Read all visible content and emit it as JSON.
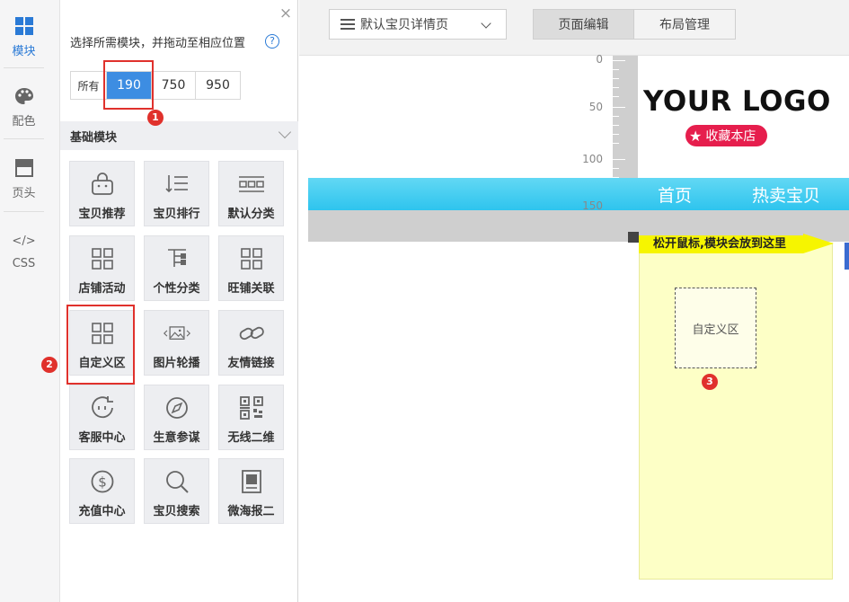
{
  "rail": {
    "items": [
      {
        "label": "模块",
        "icon": "grid-icon",
        "active": true
      },
      {
        "label": "配色",
        "icon": "palette-icon",
        "active": false
      },
      {
        "label": "页头",
        "icon": "header-icon",
        "active": false
      },
      {
        "label": "CSS",
        "icon": "code-icon",
        "active": false
      }
    ],
    "css_glyph": "</>"
  },
  "panel": {
    "close_glyph": "×",
    "hint": "选择所需模块，并拖动至相应位置",
    "help_glyph": "?",
    "width_options": [
      "所有",
      "190",
      "750",
      "950"
    ],
    "selected_width": "190",
    "section_title": "基础模块",
    "modules": [
      {
        "label": "宝贝推荐",
        "icon": "bag-icon"
      },
      {
        "label": "宝贝排行",
        "icon": "sort-list-icon"
      },
      {
        "label": "默认分类",
        "icon": "category-bars-icon"
      },
      {
        "label": "店铺活动",
        "icon": "grid-four-icon"
      },
      {
        "label": "个性分类",
        "icon": "tree-icon"
      },
      {
        "label": "旺铺关联",
        "icon": "grid-four-icon"
      },
      {
        "label": "自定义区",
        "icon": "grid-four-icon"
      },
      {
        "label": "图片轮播",
        "icon": "image-carousel-icon"
      },
      {
        "label": "友情链接",
        "icon": "link-icon"
      },
      {
        "label": "客服中心",
        "icon": "service-face-icon"
      },
      {
        "label": "生意参谋",
        "icon": "compass-icon"
      },
      {
        "label": "无线二维",
        "icon": "qrcode-icon"
      },
      {
        "label": "充值中心",
        "icon": "dollar-icon"
      },
      {
        "label": "宝贝搜索",
        "icon": "search-icon"
      },
      {
        "label": "微海报二",
        "icon": "poster-icon"
      }
    ]
  },
  "annotations": [
    "1",
    "2",
    "3"
  ],
  "toolbar": {
    "page_select": "默认宝贝详情页",
    "tabs": [
      "页面编辑",
      "布局管理"
    ],
    "active_tab": "页面编辑"
  },
  "ruler": {
    "labels": [
      "0",
      "50",
      "100",
      "150"
    ]
  },
  "preview": {
    "logo": "YOUR LOGO",
    "favorite": "收藏本店",
    "nav": [
      "首页",
      "热卖宝贝"
    ]
  },
  "drop": {
    "message": "松开鼠标,模块会放到这里",
    "dragged_label": "自定义区"
  },
  "colors": {
    "accent": "#3d8de2",
    "annotation": "#e0312c",
    "drop_zone": "#fdffc6",
    "drop_message": "#f6f500",
    "nav_bar": "#2ec4ee",
    "favorite_button": "#e61e4d"
  }
}
